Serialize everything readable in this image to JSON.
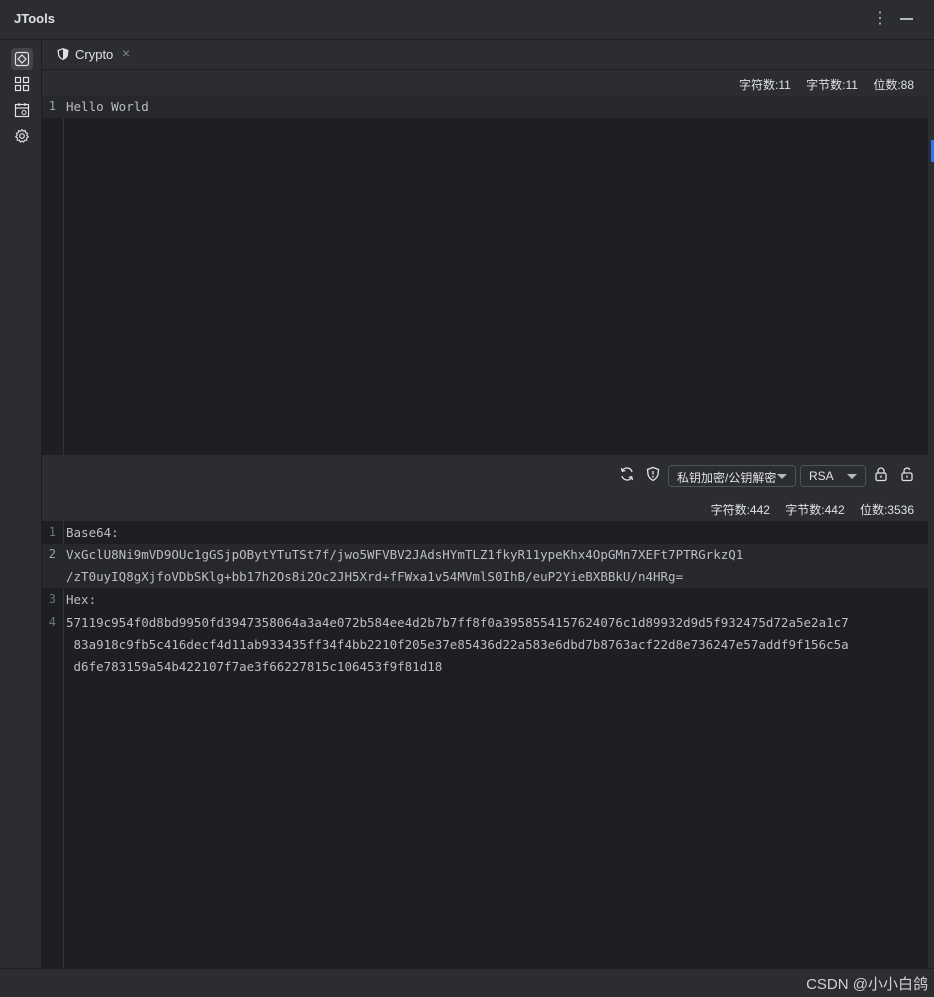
{
  "app": {
    "title": "JTools"
  },
  "sidebar": {
    "items": [
      {
        "icon": "crypto-icon",
        "active": true
      },
      {
        "icon": "grid-icon",
        "active": false
      },
      {
        "icon": "calendar-icon",
        "active": false
      },
      {
        "icon": "gear-icon",
        "active": false
      }
    ]
  },
  "tabs": [
    {
      "label": "Crypto",
      "icon": "shield-icon",
      "close": "×"
    }
  ],
  "input": {
    "stats": {
      "chars": "字符数:11",
      "bytes": "字节数:11",
      "bits": "位数:88"
    },
    "lines": [
      {
        "num": "1",
        "text": "Hello World"
      }
    ]
  },
  "toolbar": {
    "mode": "私钥加密/公钥解密",
    "algorithm": "RSA"
  },
  "output": {
    "stats": {
      "chars": "字符数:442",
      "bytes": "字节数:442",
      "bits": "位数:3536"
    },
    "lines": [
      {
        "num": "1",
        "text": "Base64:"
      },
      {
        "num": "2",
        "text": "VxGclU8Ni9mVD9OUc1gGSjpOBytYTuTSt7f/jwo5WFVBV2JAdsHYmTLZ1fkyR11ypeKhx4OpGMn7XEFt7PTRGrkzQ1"
      },
      {
        "num": "",
        "text": "/zT0uyIQ8gXjfoVDbSKlg+bb17h2Os8i2Oc2JH5Xrd+fFWxa1v54MVmlS0IhB/euP2YieBXBBkU/n4HRg="
      },
      {
        "num": "3",
        "text": "Hex:"
      },
      {
        "num": "4",
        "text": "57119c954f0d8bd9950fd3947358064a3a4e072b584ee4d2b7b7ff8f0a3958554157624076c1d89932d9d5f932475d72a5e2a1c7"
      },
      {
        "num": "",
        "text": " 83a918c9fb5c416decf4d11ab933435ff34f4bb2210f205e37e85436d22a583e6dbd7b8763acf22d8e736247e57addf9f156c5a"
      },
      {
        "num": "",
        "text": " d6fe783159a54b422107f7ae3f66227815c106453f9f81d18"
      }
    ]
  },
  "statusbar": {
    "watermark": "CSDN @小小白鸽"
  }
}
